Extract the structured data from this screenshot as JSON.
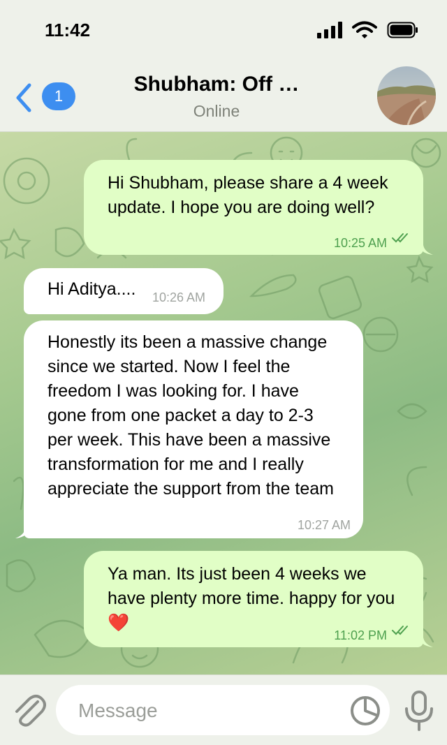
{
  "status_bar": {
    "time": "11:42"
  },
  "header": {
    "back_icon": "chevron-left-icon",
    "unread_count": "1",
    "title": "Shubham: Off …",
    "status": "Online"
  },
  "messages": [
    {
      "direction": "outgoing",
      "text": "Hi Shubham, please share a 4 week update. I hope you are doing well?",
      "time": "10:25 AM",
      "read": true
    },
    {
      "direction": "incoming",
      "text": "Hi Aditya....",
      "time": "10:26 AM"
    },
    {
      "direction": "incoming",
      "text": "Honestly its been a massive change since we started. Now I feel the freedom I was looking for. I have gone from one packet a day to 2-3 per week. This have been a massive transformation for me and I really appreciate the support from the team",
      "time": "10:27 AM"
    },
    {
      "direction": "outgoing",
      "text": "Ya man. Its just been 4 weeks we have plenty more time. happy for you❤️",
      "time": "11:02 PM",
      "read": true
    }
  ],
  "input": {
    "placeholder": "Message"
  },
  "colors": {
    "accent": "#3d8ef0",
    "outgoing_bubble": "#e1fec6",
    "incoming_bubble": "#ffffff",
    "timestamp_outgoing": "#4ea04f"
  }
}
